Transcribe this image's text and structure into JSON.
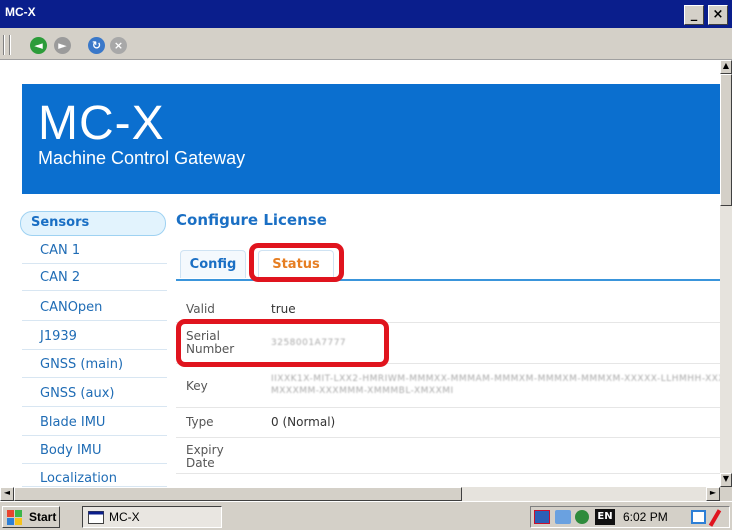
{
  "window": {
    "title": "MC-X",
    "minimize_glyph": "_",
    "close_glyph": "×"
  },
  "toolbar": {
    "icons": [
      "back-icon",
      "forward-icon",
      "refresh-icon",
      "stop-icon"
    ]
  },
  "header": {
    "logo": "MC-X",
    "subtitle": "Machine Control Gateway",
    "color": "#0b6fcf"
  },
  "sidebar": {
    "heading": "Sensors",
    "items": [
      "CAN 1",
      "CAN 2",
      "CANOpen",
      "J1939",
      "GNSS (main)",
      "GNSS (aux)",
      "Blade IMU",
      "Body IMU",
      "Localization"
    ]
  },
  "main": {
    "title": "Configure License",
    "tabs": [
      {
        "label": "Config"
      },
      {
        "label": "Status",
        "active": true
      }
    ],
    "fields": [
      {
        "label": "Valid",
        "value": "true"
      },
      {
        "label": "Serial Number",
        "value": "3258001A7777"
      },
      {
        "label": "Key",
        "value": "IIXXK1X-MIT-LXX2-HMRIWM-MMMXX-MMMAM-MMMXM-MMMXM-MMMXM-XXXXX-LLHMHH-XXXX",
        "value2": "MXXXMM-XXXMMM-XMMMBL-XMXXMI"
      },
      {
        "label": "Type",
        "value": "0 (Normal)"
      },
      {
        "label": "Expiry Date",
        "value": ""
      }
    ]
  },
  "taskbar": {
    "start": "Start",
    "task": "MC-X",
    "tray_badge": "EN",
    "clock": "6:02 PM"
  },
  "colors": {
    "accent": "#0b6fcf",
    "highlight": "#e0141e",
    "tab_active": "#e67e22"
  }
}
